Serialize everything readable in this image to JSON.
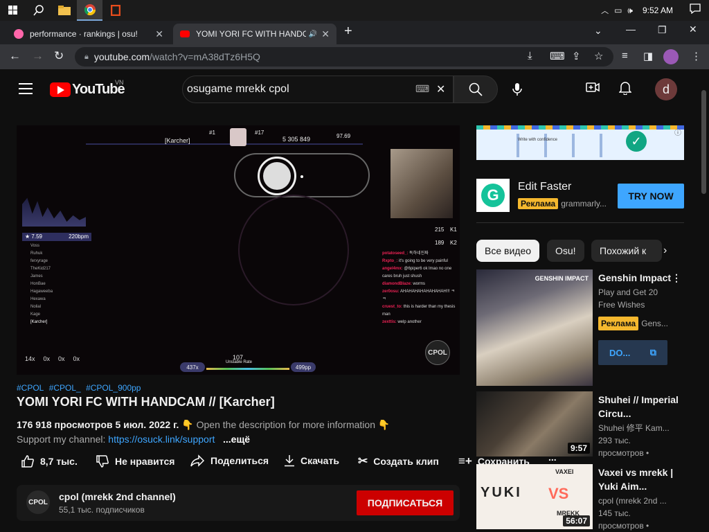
{
  "taskbar": {
    "time": "9:52 AM"
  },
  "tabs": [
    {
      "title": "performance · rankings | osu!",
      "favicon_color": "#ff66aa"
    },
    {
      "title": "YOMI YORI FC WITH HANDC",
      "favicon_color": "#ff0000",
      "audio": "🔊"
    }
  ],
  "omnibox": {
    "host": "youtube.com",
    "path": "/watch?v=mA38dTz6H5Q"
  },
  "youtube": {
    "country_code": "VN",
    "logo_text": "YouTube",
    "search_value": "osugame mrekk cpol",
    "avatar_letter": "d"
  },
  "player": {
    "hud": {
      "player_name": "[Karcher]",
      "rank": "#1",
      "global_rank": "#17",
      "score": "5 305 849",
      "accuracy": "97.69",
      "star": "7.59",
      "bpm": "220bpm",
      "k1": "215",
      "k1_label": "K1",
      "k2": "189",
      "k2_label": "K2",
      "combo": "437x",
      "pp": "499pp",
      "unstable_rate": "107",
      "unstable_label": "Unstable Rate",
      "counters": [
        "14x",
        "0x",
        "0x",
        "0x"
      ],
      "badge": "CPOL"
    },
    "leaderboard": [
      "Voss",
      "Ruhuk",
      "ferxyrage",
      "TheKid217",
      "James",
      "HonBae",
      "Hagaweeba",
      "Hexawa",
      "Nolial",
      "Kage",
      "[Karcher]"
    ],
    "chat": [
      {
        "user": "potatoseed_:",
        "msg": "독하네진짜"
      },
      {
        "user": "Rxpto_:",
        "msg": "it's going to be very painful"
      },
      {
        "user": "angel4mx:",
        "msg": "@6piper6 ok lmao no one cares bruh just shush"
      },
      {
        "user": "diamondBlaze:",
        "msg": "worms"
      },
      {
        "user": "zer0osu:",
        "msg": "AHAHAHAHAHAHAHAH!!! ㅋㅋ"
      },
      {
        "user": "cruest_to:",
        "msg": "this is harder than my thesis man"
      },
      {
        "user": "zexttis:",
        "msg": "welp another"
      }
    ]
  },
  "video": {
    "tags": [
      "#CPOL",
      "#CPOL_",
      "#CPOL_900pp"
    ],
    "title": "YOMI YORI FC WITH HANDCAM // [Karcher]",
    "views": "176 918 просмотров",
    "date": "5 июл. 2022 г.",
    "desc_line1": "👇 Open the description for more information 👇",
    "support_text": "Support my channel: ",
    "support_link": "https://osuck.link/support",
    "more": "...ещё"
  },
  "actions": {
    "like": "8,7 тыс.",
    "dislike": "Не нравится",
    "share": "Поделиться",
    "download": "Скачать",
    "clip": "Создать клип",
    "save": "Сохранить",
    "more": "..."
  },
  "channel": {
    "avatar_text": "CPOL",
    "name": "cpol (mrekk 2nd channel)",
    "subs": "55,1 тыс. подписчиков",
    "subscribe": "ПОДПИСАТЬСЯ"
  },
  "ad": {
    "banner_text": "Write with confidence",
    "title": "Edit Faster",
    "badge": "Реклама",
    "domain": "grammarly...",
    "cta": "TRY NOW"
  },
  "chips": [
    "Все видео",
    "Osu!",
    "Похожий к"
  ],
  "recommendations": [
    {
      "title": "Genshin Impact",
      "sub": "Play and Get 20 Free Wishes",
      "badge": "Реклама",
      "source": "Gens...",
      "cta": "DO...",
      "thumb_text": "GENSHIN IMPACT"
    },
    {
      "title": "Shuhei // Imperial Circu...",
      "channel": "Shuhei 修平 Kam...",
      "views": "293 тыс. просмотров •",
      "duration": "9:57"
    },
    {
      "title": "Vaxei vs mrekk | Yuki Aim...",
      "channel": "cpol (mrekk 2nd ...",
      "views": "145 тыс. просмотров •",
      "duration": "56:07",
      "thumb_left": "YUKI",
      "thumb_mid": "VS",
      "thumb_p1": "VAXEI",
      "thumb_p2": "MREKK"
    }
  ]
}
